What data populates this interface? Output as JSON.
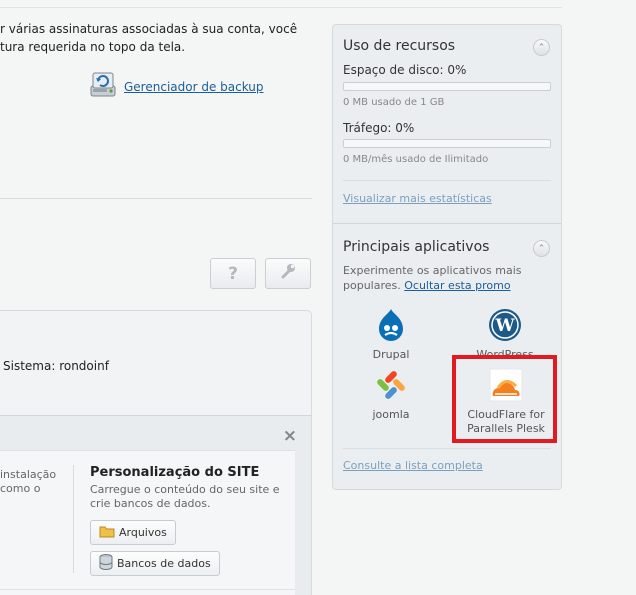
{
  "intro": {
    "line1": "r várias assinaturas associadas à sua conta, você",
    "line2": "tura requerida no topo da tela.",
    "backup_link": "Gerenciador de backup"
  },
  "toolbar": {
    "help_label": "?"
  },
  "system": {
    "label": "Sistema: rondoinf"
  },
  "customize": {
    "left_fragment_1": "instalação",
    "left_fragment_2": "como o",
    "title": "Personalização do SITE",
    "description": "Carregue o conteúdo do seu site e crie bancos de dados.",
    "files_button": "Arquivos",
    "db_button": "Bancos de dados",
    "close": "×"
  },
  "resources": {
    "title": "Uso de recursos",
    "disk_label": "Espaço de disco: 0%",
    "disk_percent": 0,
    "disk_detail": "0 MB usado de 1 GB",
    "traffic_label": "Tráfego: 0%",
    "traffic_percent": 0,
    "traffic_detail": "0 MB/mês usado de Ilimitado",
    "stats_link": "Visualizar mais estatísticas"
  },
  "apps": {
    "title": "Principais aplicativos",
    "promo_text": "Experimente os aplicativos mais populares.",
    "hide_promo": "Ocultar esta promo",
    "items": [
      {
        "name": "Drupal",
        "icon": "drupal-icon"
      },
      {
        "name": "WordPress",
        "icon": "wordpress-icon"
      },
      {
        "name": "joomla",
        "icon": "joomla-icon"
      },
      {
        "name": "CloudFlare for Parallels Plesk",
        "icon": "cloudflare-icon"
      }
    ],
    "full_list_link": "Consulte a lista completa"
  },
  "colors": {
    "link": "#1a5e9a",
    "highlight": "#e11b22",
    "bar_fill": "#4a90c8"
  }
}
